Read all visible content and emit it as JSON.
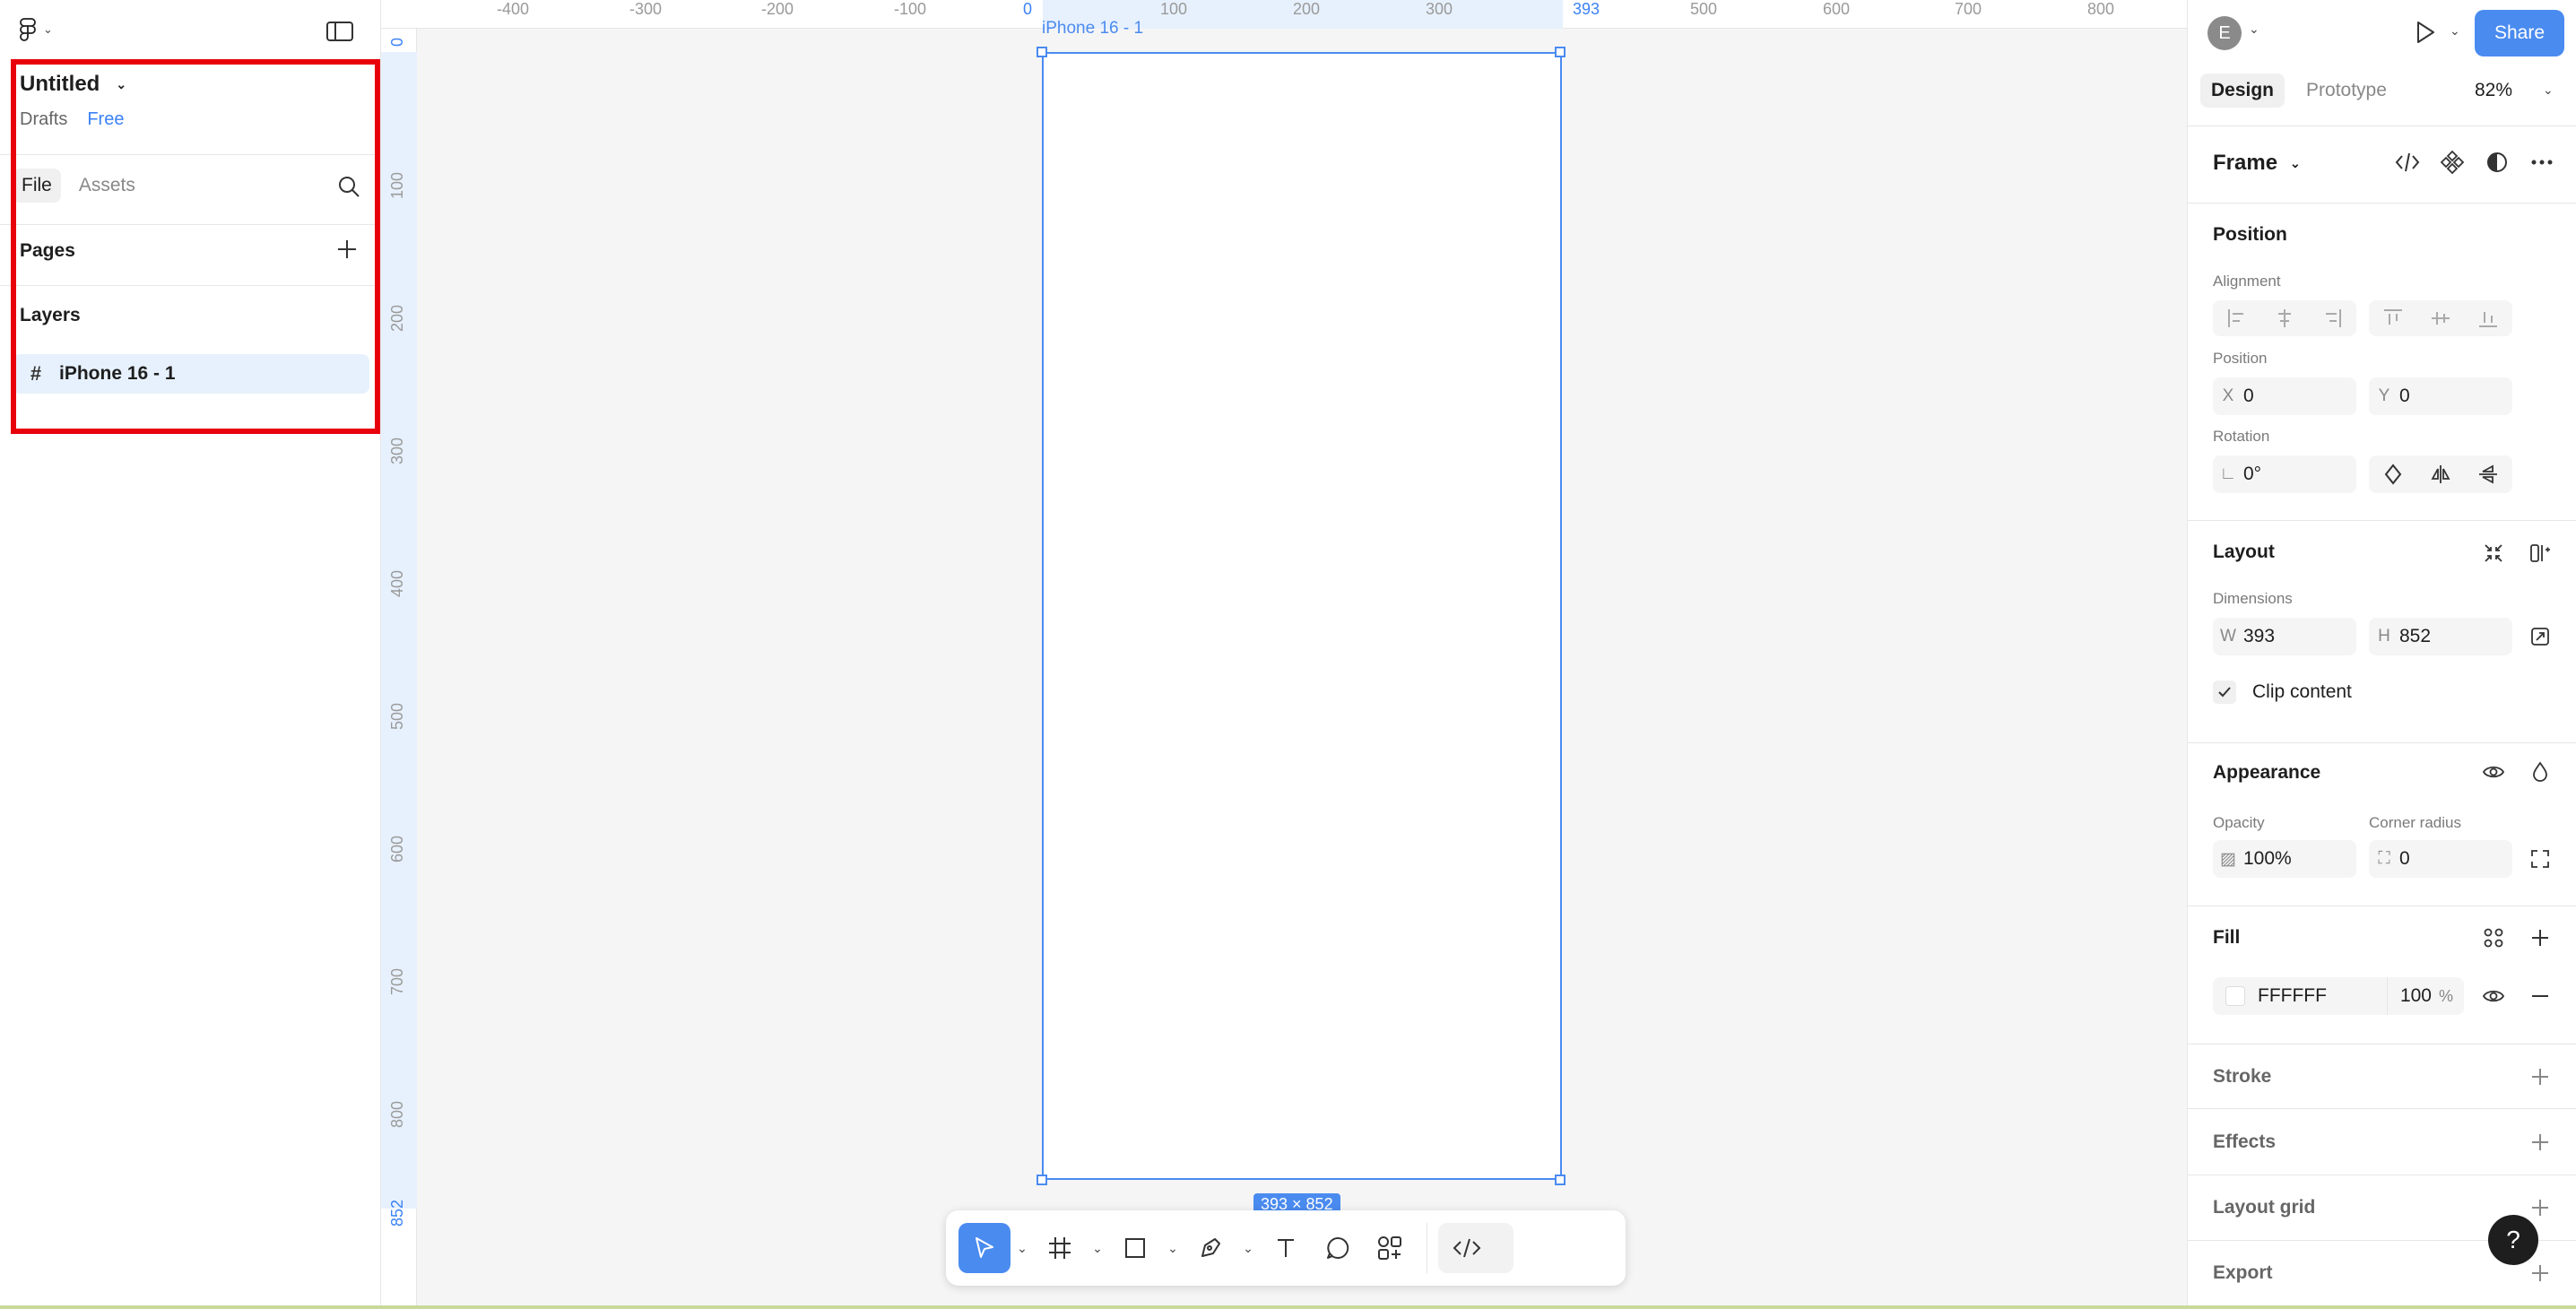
{
  "file": {
    "title": "Untitled",
    "location": "Drafts",
    "plan": "Free"
  },
  "left_tabs": [
    "File",
    "Assets"
  ],
  "sections": {
    "pages": "Pages",
    "layers": "Layers"
  },
  "layers": [
    {
      "name": "iPhone 16 - 1",
      "icon": "frame-icon"
    }
  ],
  "ruler": {
    "x_ticks": [
      "-400",
      "-300",
      "-200",
      "-100",
      "0",
      "100",
      "200",
      "300",
      "393",
      "500",
      "600",
      "700",
      "800"
    ],
    "y_ticks": [
      "0",
      "100",
      "200",
      "300",
      "400",
      "500",
      "600",
      "700",
      "800",
      "852"
    ]
  },
  "canvas": {
    "frame_label": "iPhone 16 - 1",
    "dimensions_badge": "393 × 852"
  },
  "header": {
    "avatar_initial": "E",
    "share_label": "Share"
  },
  "right_tabs": [
    "Design",
    "Prototype"
  ],
  "zoom": "82%",
  "design": {
    "frame_type": "Frame",
    "position_title": "Position",
    "alignment_label": "Alignment",
    "position_label": "Position",
    "x_prefix": "X",
    "x_value": "0",
    "y_prefix": "Y",
    "y_value": "0",
    "rotation_label": "Rotation",
    "rotation_value": "0°",
    "layout_title": "Layout",
    "dimensions_label": "Dimensions",
    "w_prefix": "W",
    "w_value": "393",
    "h_prefix": "H",
    "h_value": "852",
    "clip_content": "Clip content",
    "appearance_title": "Appearance",
    "opacity_label": "Opacity",
    "opacity_value": "100%",
    "corner_radius_label": "Corner radius",
    "corner_radius_value": "0",
    "fill_title": "Fill",
    "fill_hex": "FFFFFF",
    "fill_opacity": "100",
    "fill_pct_sign": "%",
    "stroke_title": "Stroke",
    "effects_title": "Effects",
    "layout_grid_title": "Layout grid",
    "export_title": "Export"
  },
  "help_label": "?",
  "colors": {
    "accent": "#4a8bf0",
    "highlight_border": "#e8000b",
    "selection_bg": "#e7f1fd"
  }
}
